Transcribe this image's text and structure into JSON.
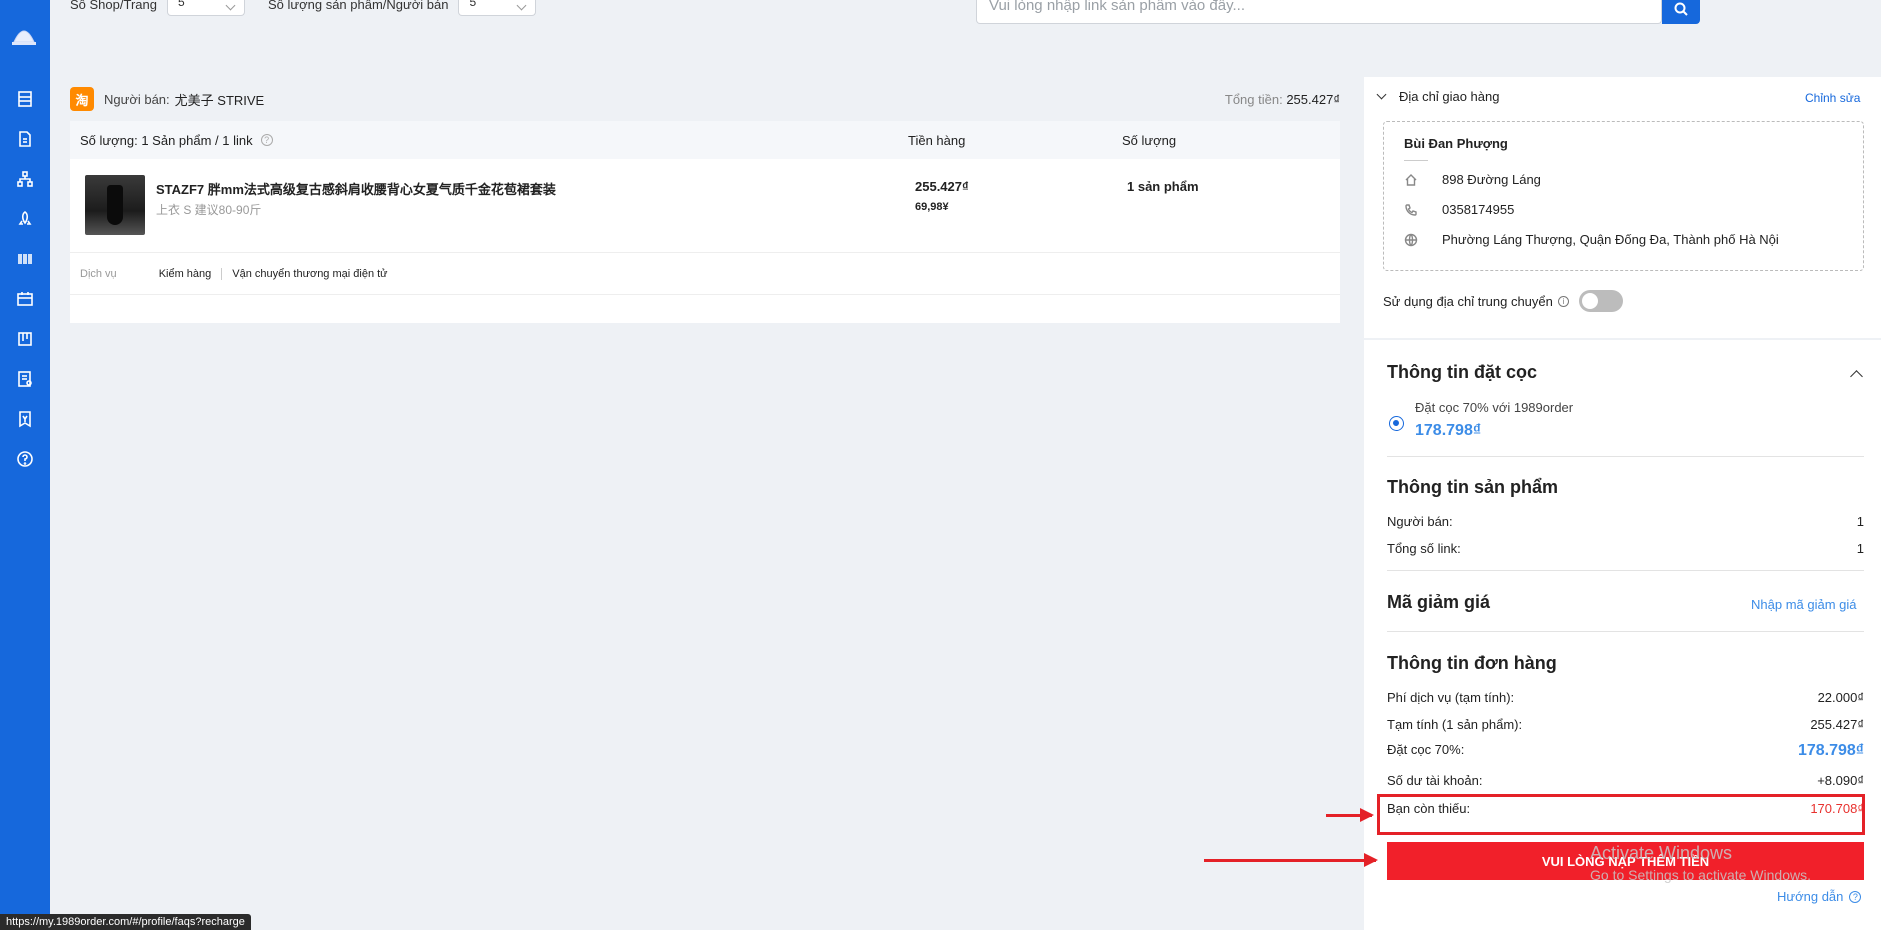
{
  "topbar": {
    "filter1_label": "Số Shop/Trang",
    "filter1_value": "5",
    "filter2_label": "Số lượng sản phẩm/Người bán",
    "filter2_value": "5",
    "search_placeholder": "Vui lòng nhập link sản phẩm vào đây..."
  },
  "seller": {
    "logo_glyph": "淘",
    "label": "Người bán:",
    "name": "尤美子 STRIVE",
    "total_label": "Tổng tiền:",
    "total_value": "255.427₫"
  },
  "order": {
    "count_label": "Số lượng:",
    "count_value": "1 Sản phẩm / 1 link",
    "col_price": "Tiền hàng",
    "col_qty": "Số lượng",
    "product": {
      "name": "STAZF7 胖mm法式高级复古感斜肩收腰背心女夏气质千金花苞裙套装",
      "variant": "上衣    S 建议80-90斤",
      "price": "255.427₫",
      "price_cny": "69,98¥",
      "qty": "1 sản phẩm"
    },
    "service_label": "Dịch vụ",
    "services": [
      "Kiểm hàng",
      "Vận chuyển thương mại điện tử"
    ]
  },
  "address": {
    "title": "Địa chỉ giao hàng",
    "edit": "Chỉnh sửa",
    "name": "Bùi Đan Phượng",
    "street": "898 Đường Láng",
    "phone": "0358174955",
    "area": "Phường Láng Thượng, Quận Đống Đa, Thành phố Hà Nội",
    "transit_label": "Sử dụng địa chỉ trung chuyển"
  },
  "deposit": {
    "title": "Thông tin đặt cọc",
    "option_label": "Đặt cọc 70% với 1989order",
    "option_amount": "178.798₫"
  },
  "product_info": {
    "title": "Thông tin sản phẩm",
    "seller_label": "Người bán:",
    "seller_value": "1",
    "links_label": "Tổng số link:",
    "links_value": "1"
  },
  "voucher": {
    "title": "Mã giảm giá",
    "link": "Nhập mã giảm giá"
  },
  "order_info": {
    "title": "Thông tin đơn hàng",
    "service_fee_label": "Phí dịch vụ (tạm tính):",
    "service_fee_value": "22.000₫",
    "subtotal_label": "Tạm tính (1 sản phẩm):",
    "subtotal_value": "255.427₫",
    "deposit_label": "Đặt cọc 70%:",
    "deposit_value": "178.798₫",
    "balance_label": "Số dư tài khoản:",
    "balance_value": "+8.090₫",
    "missing_label": "Bạn còn thiếu:",
    "missing_value": "170.708₫"
  },
  "cta": {
    "label": "VUI LÒNG NẠP THÊM TIỀN",
    "guide": "Hướng dẫn"
  },
  "watermark": {
    "title": "Activate Windows",
    "sub": "Go to Settings to activate Windows."
  },
  "status_url": "https://my.1989order.com/#/profile/faqs?recharge",
  "colors": {
    "primary": "#1668dc",
    "accent_blue": "#3c8ce7",
    "danger": "#e42127",
    "cta_red": "#f1202a"
  }
}
